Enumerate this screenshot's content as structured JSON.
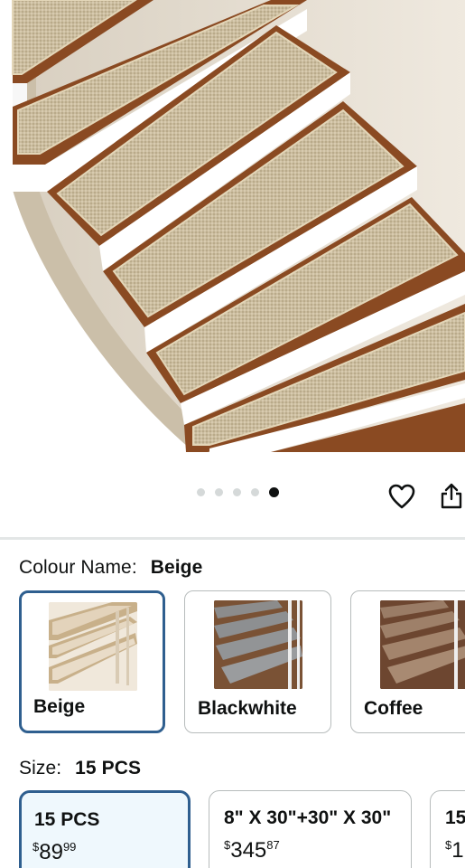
{
  "product": {
    "image_alt": "Beige stair tread mats on a curved wooden staircase",
    "carousel": {
      "total": 5,
      "active_index": 4
    }
  },
  "actions": {
    "wishlist_icon": "heart-icon",
    "share_icon": "share-icon"
  },
  "colour": {
    "label": "Colour Name:",
    "selected": "Beige",
    "options": [
      {
        "name": "Beige",
        "selected": true
      },
      {
        "name": "Blackwhite",
        "selected": false
      },
      {
        "name": "Coffee",
        "selected": false
      }
    ]
  },
  "size": {
    "label": "Size:",
    "selected": "15 PCS",
    "options": [
      {
        "name": "15 PCS",
        "currency": "$",
        "whole": "89",
        "fraction": "99",
        "selected": true
      },
      {
        "name": "8\" X 30\"+30\" X 30\"",
        "currency": "$",
        "whole": "345",
        "fraction": "87",
        "selected": false
      },
      {
        "name": "15",
        "currency": "$",
        "whole": "1",
        "fraction": "",
        "selected": false
      }
    ]
  },
  "colors": {
    "selected_border": "#2f5f8f",
    "selected_bg": "#eff8fd",
    "tread": "#cfc0a3",
    "wood": "#8a4a22",
    "riser": "#ffffff"
  }
}
